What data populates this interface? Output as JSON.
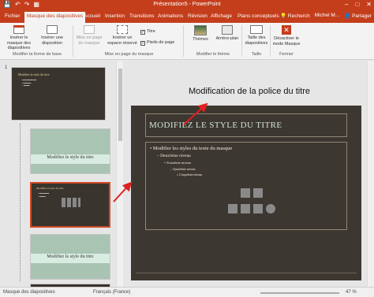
{
  "window": {
    "title": "Présentation5 - PowerPoint",
    "qat": [
      "💾",
      "↶",
      "↷",
      "▦"
    ],
    "controls": [
      "–",
      "□",
      "✕"
    ]
  },
  "tabs": {
    "items": [
      "Fichier",
      "Masque des diapositives",
      "Accueil",
      "Insertion",
      "Transitions",
      "Animations",
      "Révision",
      "Affichage",
      "Plans conceptuels"
    ],
    "active_index": 1,
    "search": "Recherch",
    "user": "Michel M...",
    "share": "Partager"
  },
  "ribbon": {
    "insert_master": "Insérer le masque des diapositives",
    "insert_layout": "Insérer une disposition",
    "master_layout": "Mise en page du masque",
    "insert_placeholder": "Insérer un espace réservé",
    "title_check": "Titre",
    "footer_check": "Pieds de page",
    "themes": "Thèmes",
    "background": "Arrière-plan",
    "slide_size": "Taille des diapositives",
    "close_master": "Désactiver le mode Masque",
    "groups": {
      "edit_master": "Modifier la forme de base",
      "master_layout": "Mise en page du masque",
      "edit_theme": "Modifier le thème",
      "size": "Taille",
      "close": "Fermer"
    }
  },
  "thumbnails": {
    "slide_number": "1",
    "master_title": "Modifiez le style du titre",
    "thumb_title": "Modifiez le style du titre"
  },
  "main": {
    "heading": "Modification de la police du titre",
    "slide_title": "MODIFIEZ LE STYLE DU TITRE",
    "levels": [
      "• Modifier les styles du texte du masque",
      "– Deuxième niveau",
      "• Troisième niveau",
      "– Quatrième niveau",
      "» Cinquième niveau"
    ]
  },
  "status": {
    "view": "Masque des diapositives",
    "language": "Français (France)",
    "zoom": "47 %"
  },
  "colors": {
    "accent": "#c43e1c",
    "slide_bg": "#3d3731",
    "title_color": "#cde6d3",
    "arrow": "#e02020"
  }
}
